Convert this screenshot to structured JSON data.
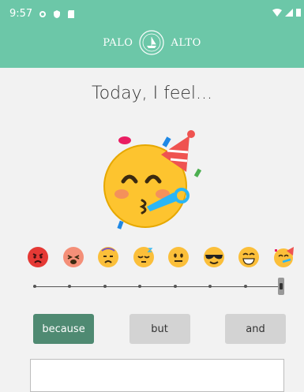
{
  "status_bar": {
    "time": "9:57",
    "left_icons": [
      "gear-icon",
      "shield-icon",
      "sd-card-icon"
    ],
    "right_icons": [
      "wifi-icon",
      "signal-icon",
      "battery-icon"
    ]
  },
  "header": {
    "brand_left": "PALO",
    "brand_right": "ALTO",
    "seal_icon": "palo-alto-seal-icon",
    "background": "#6cc7a8"
  },
  "prompt": {
    "title": "Today, I feel..."
  },
  "mood": {
    "selected_index": 7,
    "selected_icon": "partying-face-icon",
    "options": [
      {
        "icon": "angry-face-icon"
      },
      {
        "icon": "exhausted-face-icon"
      },
      {
        "icon": "dizzy-face-icon"
      },
      {
        "icon": "sleepy-face-icon"
      },
      {
        "icon": "neutral-face-icon"
      },
      {
        "icon": "sunglasses-face-icon"
      },
      {
        "icon": "grinning-face-icon"
      },
      {
        "icon": "partying-face-icon"
      }
    ]
  },
  "buttons": {
    "because": "because",
    "but": "but",
    "and": "and",
    "active": "because",
    "active_color": "#4f8a72"
  }
}
